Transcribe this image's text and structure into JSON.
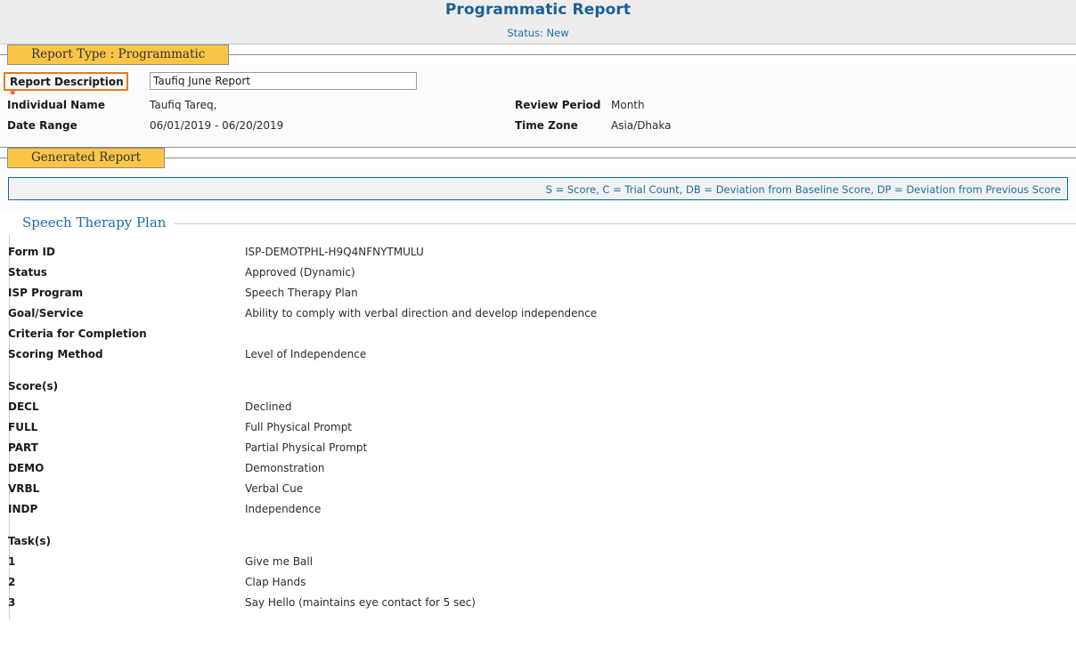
{
  "header": {
    "title": "Programmatic Report",
    "status": "Status: New",
    "title_color": "#1b5f96"
  },
  "report_type_section": {
    "legend": "Report Type :  Programmatic",
    "description": {
      "label": "Report Description",
      "required_marker": "*",
      "value": "Taufiq June Report",
      "placeholder": ""
    },
    "fields_left": [
      {
        "label": "Individual Name",
        "value": "Taufiq  Tareq,"
      },
      {
        "label": "Date Range",
        "value": "06/01/2019 - 06/20/2019"
      }
    ],
    "fields_right": [
      {
        "label": "Review Period",
        "value": "Month"
      },
      {
        "label": "Time Zone",
        "value": "Asia/Dhaka"
      }
    ]
  },
  "generated_report_section": {
    "legend": "Generated Report",
    "key_legend": "S = Score,  C = Trial Count,  DB = Deviation from Baseline Score,  DP = Deviation from Previous Score",
    "key_legend_color": "#1b6ea6",
    "plan": {
      "title": "Speech Therapy Plan",
      "details": [
        {
          "label": "Form ID",
          "value": "ISP-DEMOTPHL-H9Q4NFNYTMULU"
        },
        {
          "label": "Status",
          "value": "Approved (Dynamic)"
        },
        {
          "label": "ISP Program",
          "value": "Speech Therapy Plan"
        },
        {
          "label": "Goal/Service",
          "value": "Ability to comply with verbal direction and develop independence"
        },
        {
          "label": "Criteria for Completion",
          "value": ""
        },
        {
          "label": "Scoring Method",
          "value": "Level of Independence"
        }
      ],
      "scores_heading": "Score(s)",
      "scores": [
        {
          "label": "DECL",
          "value": "Declined"
        },
        {
          "label": "FULL",
          "value": "Full Physical Prompt"
        },
        {
          "label": "PART",
          "value": "Partial Physical Prompt"
        },
        {
          "label": "DEMO",
          "value": "Demonstration"
        },
        {
          "label": "VRBL",
          "value": "Verbal Cue"
        },
        {
          "label": "INDP",
          "value": "Independence"
        }
      ],
      "tasks_heading": "Task(s)",
      "tasks": [
        {
          "label": "1",
          "value": "Give me Ball"
        },
        {
          "label": "2",
          "value": "Clap Hands"
        },
        {
          "label": "3",
          "value": "Say Hello (maintains eye contact for 5 sec)"
        }
      ]
    }
  }
}
